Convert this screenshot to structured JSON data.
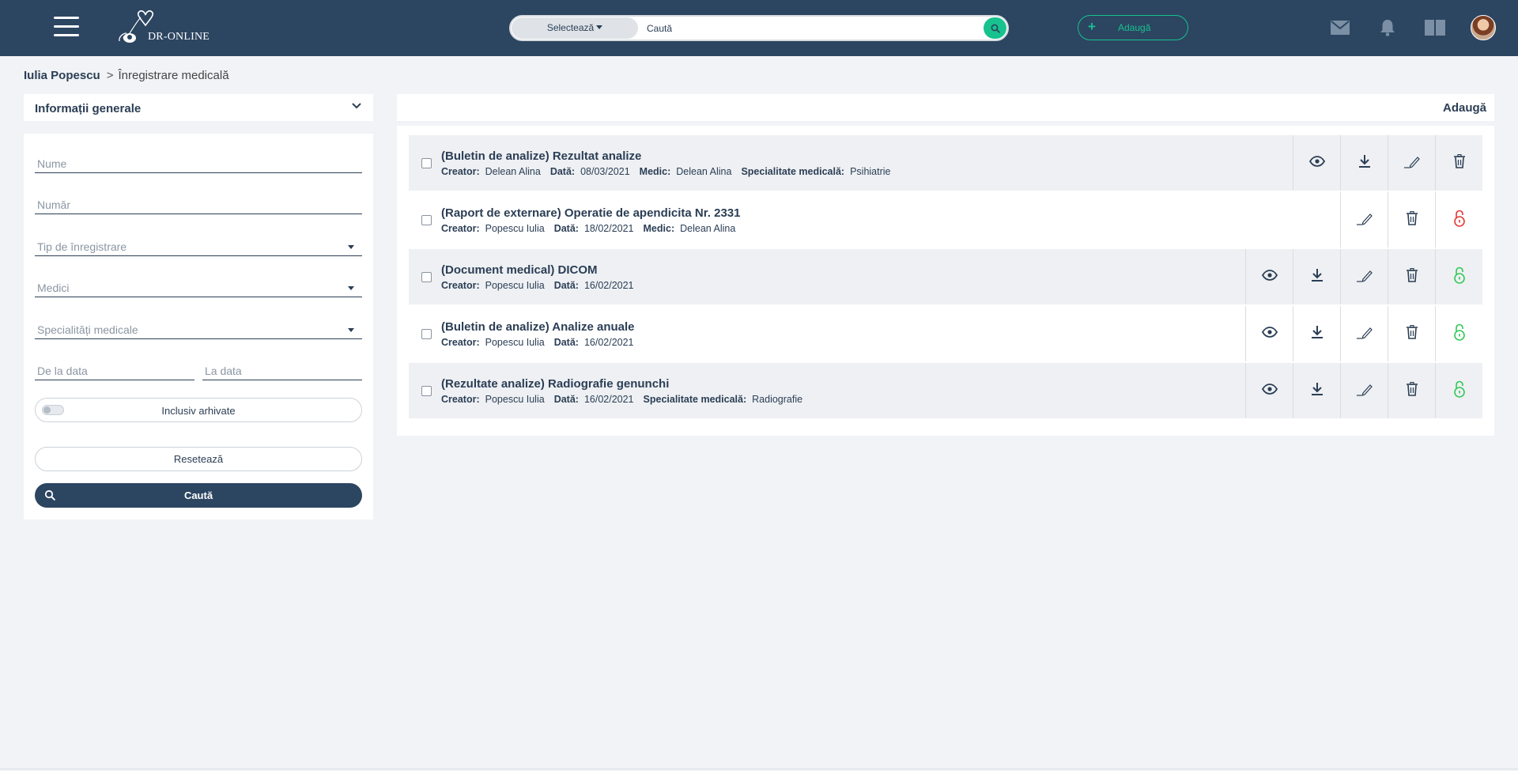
{
  "header": {
    "logo_text": "DR-ONLINE",
    "search_select_label": "Selectează",
    "search_placeholder": "Caută",
    "add_label": "Adaugă",
    "accent_color": "#17c28e",
    "bar_color": "#2c4561"
  },
  "breadcrumb": {
    "patient": "Iulia Popescu",
    "separator": ">",
    "current": "Înregistrare medicală"
  },
  "filters": {
    "section_title": "Informații generale",
    "name_placeholder": "Nume",
    "number_placeholder": "Număr",
    "type_placeholder": "Tip de înregistrare",
    "doctors_placeholder": "Medici",
    "specialties_placeholder": "Specialități medicale",
    "from_date_placeholder": "De la data",
    "to_date_placeholder": "La data",
    "archived_label": "Inclusiv arhivate",
    "archived_on": false,
    "reset_label": "Resetează",
    "search_label": "Caută"
  },
  "list": {
    "add_label": "Adaugă",
    "labels": {
      "creator": "Creator:",
      "date": "Dată:",
      "doctor": "Medic:",
      "specialty": "Specialitate medicală:"
    },
    "records": [
      {
        "title": "(Buletin de analize) Rezultat analize",
        "creator": "Delean Alina",
        "date": "08/03/2021",
        "doctor": "Delean Alina",
        "specialty": "Psihiatrie",
        "actions": [
          "view-icon",
          "download-icon",
          "edit-icon",
          "trash-icon"
        ]
      },
      {
        "title": "(Raport de externare) Operatie de apendicita Nr. 2331",
        "creator": "Popescu Iulia",
        "date": "18/02/2021",
        "doctor": "Delean Alina",
        "specialty": "",
        "actions": [
          "edit-icon",
          "trash-icon",
          "lock-icon-red"
        ]
      },
      {
        "title": "(Document medical) DICOM",
        "creator": "Popescu Iulia",
        "date": "16/02/2021",
        "doctor": "",
        "specialty": "",
        "actions": [
          "view-icon",
          "download-icon",
          "edit-icon",
          "trash-icon",
          "lock-icon-green"
        ]
      },
      {
        "title": "(Buletin de analize) Analize anuale",
        "creator": "Popescu Iulia",
        "date": "16/02/2021",
        "doctor": "",
        "specialty": "",
        "actions": [
          "view-icon",
          "download-icon",
          "edit-icon",
          "trash-icon",
          "lock-icon-green"
        ]
      },
      {
        "title": "(Rezultate analize) Radiografie genunchi",
        "creator": "Popescu Iulia",
        "date": "16/02/2021",
        "doctor": "",
        "specialty": "Radiografie",
        "actions": [
          "view-icon",
          "download-icon",
          "edit-icon",
          "trash-icon",
          "lock-icon-green"
        ]
      }
    ],
    "lock_red_color": "#e53935",
    "lock_green_color": "#35c759"
  }
}
